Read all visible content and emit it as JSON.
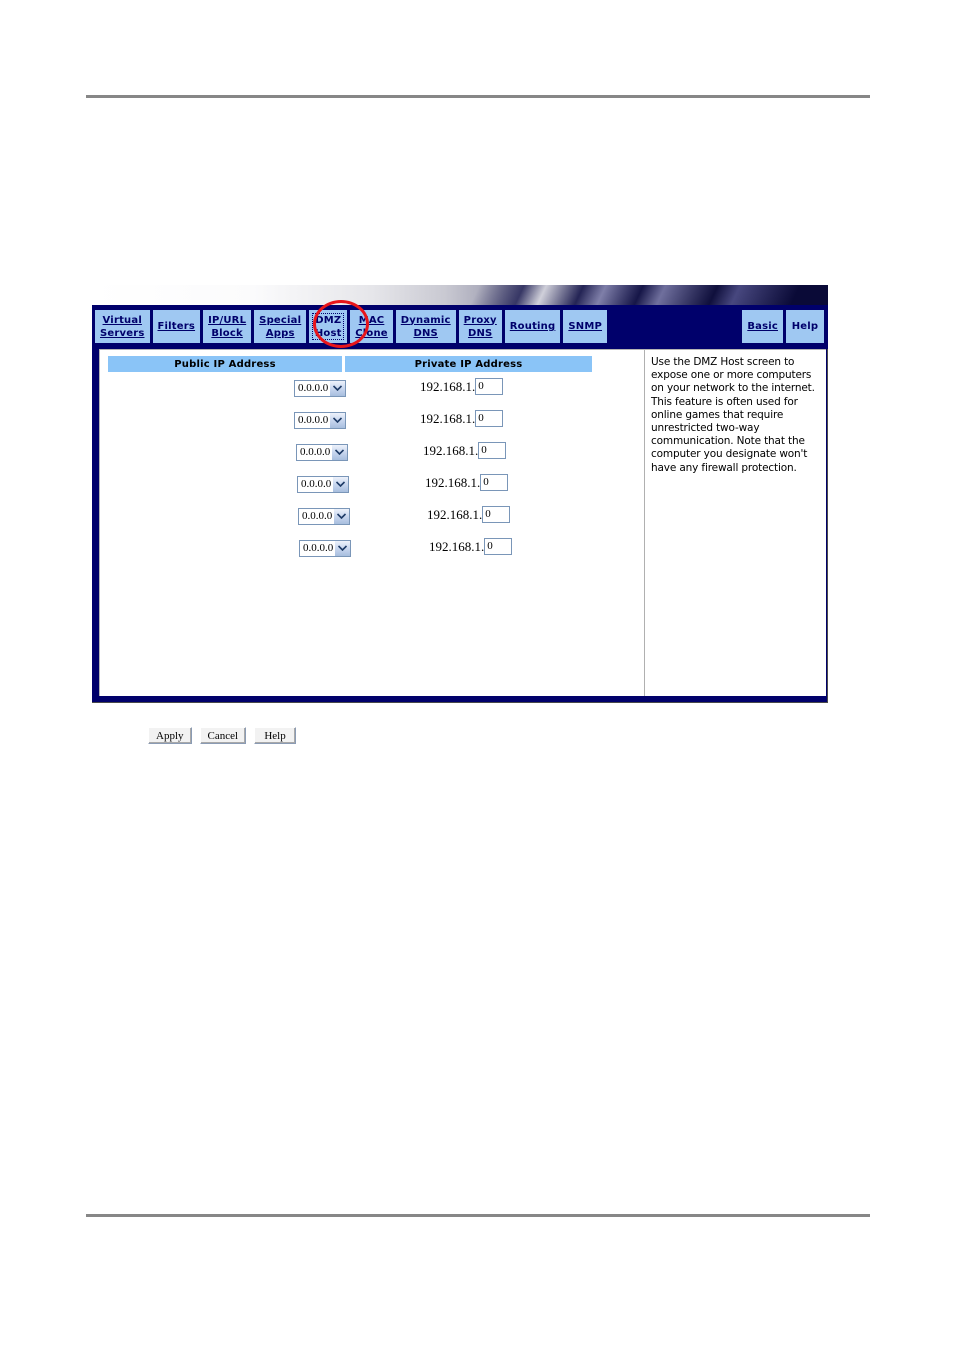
{
  "screen": {
    "nav_tabs": [
      {
        "name": "virtual-servers",
        "lines": [
          "Virtual",
          "Servers"
        ],
        "current": false,
        "underline": true
      },
      {
        "name": "filters",
        "lines": [
          "Filters"
        ],
        "current": false,
        "underline": true
      },
      {
        "name": "ip-url-block",
        "lines": [
          "IP/URL",
          "Block"
        ],
        "current": false,
        "underline": true
      },
      {
        "name": "special-apps",
        "lines": [
          "Special",
          "Apps"
        ],
        "current": false,
        "underline": true
      },
      {
        "name": "dmz-host",
        "lines": [
          "DMZ",
          "Host"
        ],
        "current": true,
        "underline": false
      },
      {
        "name": "mac-clone",
        "lines": [
          "MAC",
          "Clone"
        ],
        "current": false,
        "underline": true
      },
      {
        "name": "dynamic-dns",
        "lines": [
          "Dynamic",
          "DNS"
        ],
        "current": false,
        "underline": true
      },
      {
        "name": "proxy-dns",
        "lines": [
          "Proxy",
          "DNS"
        ],
        "current": false,
        "underline": true
      },
      {
        "name": "routing",
        "lines": [
          "Routing"
        ],
        "current": false,
        "underline": true
      },
      {
        "name": "snmp",
        "lines": [
          "SNMP"
        ],
        "current": false,
        "underline": true
      }
    ],
    "nav_right_tabs": [
      {
        "name": "basic",
        "lines": [
          "Basic"
        ],
        "underline": true
      },
      {
        "name": "help",
        "lines": [
          "Help"
        ],
        "underline": false
      }
    ],
    "table": {
      "headers": {
        "public": "Public IP Address",
        "private": "Private IP Address"
      },
      "rows": [
        {
          "public_value": "0.0.0.0",
          "private_prefix": "192.168.1.",
          "private_value": "0"
        },
        {
          "public_value": "0.0.0.0",
          "private_prefix": "192.168.1.",
          "private_value": "0"
        },
        {
          "public_value": "0.0.0.0",
          "private_prefix": "192.168.1.",
          "private_value": "0"
        },
        {
          "public_value": "0.0.0.0",
          "private_prefix": "192.168.1.",
          "private_value": "0"
        },
        {
          "public_value": "0.0.0.0",
          "private_prefix": "192.168.1.",
          "private_value": "0"
        },
        {
          "public_value": "0.0.0.0",
          "private_prefix": "192.168.1.",
          "private_value": "0"
        }
      ]
    },
    "help_panel": {
      "text": "Use the DMZ Host screen to expose one or more computers on your network to the internet. This feature is often used for online games that require unrestricted two-way communication. Note that the computer you designate won't have any firewall protection."
    },
    "buttons": [
      {
        "name": "apply-button",
        "label": "Apply"
      },
      {
        "name": "cancel-button",
        "label": "Cancel"
      },
      {
        "name": "help-button",
        "label": "Help"
      }
    ],
    "colors": {
      "nav_background": "#00006b",
      "tab_background": "#9fc8f2",
      "column_header_background": "#8ac4f7",
      "annotation": "#e8151a"
    }
  }
}
